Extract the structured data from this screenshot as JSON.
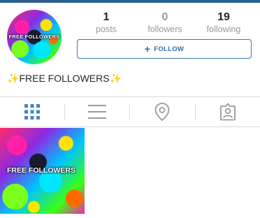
{
  "profile": {
    "avatar_text": "FREE FOLLOWERS",
    "bio": "FREE FOLLOWERS",
    "bio_sparkle": "✨"
  },
  "stats": [
    {
      "count": "1",
      "label": "posts"
    },
    {
      "count": "0",
      "label": "followers"
    },
    {
      "count": "19",
      "label": "following"
    }
  ],
  "follow_button": {
    "label": "FOLLOW",
    "icon": "plus-icon"
  },
  "tabs": [
    {
      "name": "grid",
      "icon": "grid-icon",
      "active": true
    },
    {
      "name": "list",
      "icon": "list-icon",
      "active": false
    },
    {
      "name": "map",
      "icon": "location-pin-icon",
      "active": false
    },
    {
      "name": "tagged",
      "icon": "tagged-person-icon",
      "active": false
    }
  ],
  "posts": [
    {
      "text": "FREE FOLLOWERS"
    }
  ],
  "colors": {
    "accent": "#3d7ab8",
    "topbar": "#2c5f8d",
    "active_tab": "#3f86c9",
    "inactive_tab": "#9a9a9a"
  }
}
